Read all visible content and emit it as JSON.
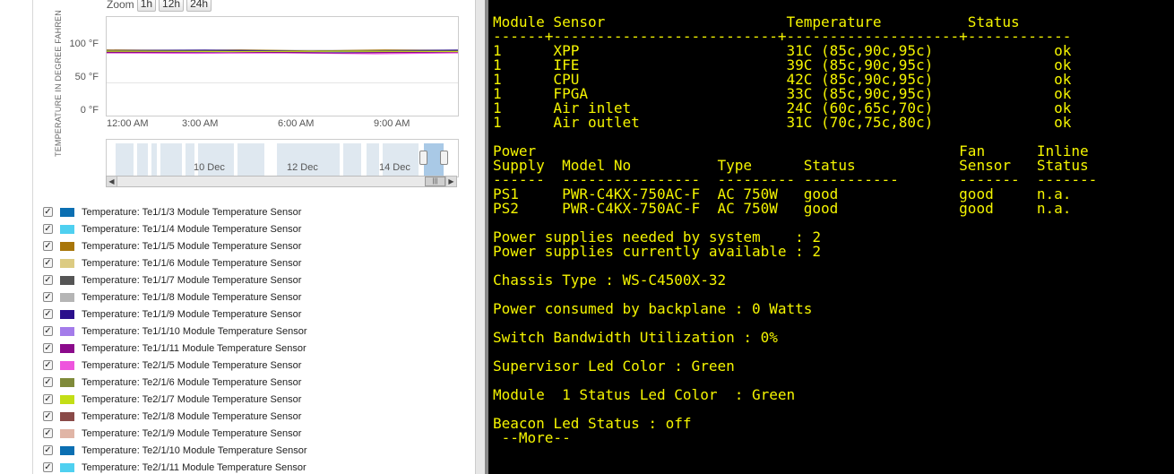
{
  "left_panel": {
    "zoom_label": "Zoom",
    "zoom_buttons": [
      "1h",
      "12h",
      "24h"
    ],
    "y_axis_label": "TEMPERATURE IN DEGREE FAHREN",
    "y_ticks": [
      "100 °F",
      "50 °F",
      "0 °F"
    ],
    "x_ticks": [
      "12:00 AM",
      "3:00 AM",
      "6:00 AM",
      "9:00 AM"
    ],
    "navigator_ticks": [
      "10 Dec",
      "12 Dec",
      "14 Dec"
    ],
    "legend": [
      {
        "label": "Temperature: Te1/1/3 Module Temperature Sensor",
        "color": "#0b6fb2"
      },
      {
        "label": "Temperature: Te1/1/4 Module Temperature Sensor",
        "color": "#4fd0f0"
      },
      {
        "label": "Temperature: Te1/1/5 Module Temperature Sensor",
        "color": "#a8760a"
      },
      {
        "label": "Temperature: Te1/1/6 Module Temperature Sensor",
        "color": "#dccb82"
      },
      {
        "label": "Temperature: Te1/1/7 Module Temperature Sensor",
        "color": "#555555"
      },
      {
        "label": "Temperature: Te1/1/8 Module Temperature Sensor",
        "color": "#b5b5b5"
      },
      {
        "label": "Temperature: Te1/1/9 Module Temperature Sensor",
        "color": "#2b0f8c"
      },
      {
        "label": "Temperature: Te1/1/10 Module Temperature Sensor",
        "color": "#a47cea"
      },
      {
        "label": "Temperature: Te1/1/11 Module Temperature Sensor",
        "color": "#8b0a8b"
      },
      {
        "label": "Temperature: Te2/1/5 Module Temperature Sensor",
        "color": "#ee55dd"
      },
      {
        "label": "Temperature: Te2/1/6 Module Temperature Sensor",
        "color": "#7f8a3a"
      },
      {
        "label": "Temperature: Te2/1/7 Module Temperature Sensor",
        "color": "#c3de16"
      },
      {
        "label": "Temperature: Te2/1/8 Module Temperature Sensor",
        "color": "#8a4a48"
      },
      {
        "label": "Temperature: Te2/1/9 Module Temperature Sensor",
        "color": "#e0b5a6"
      },
      {
        "label": "Temperature: Te2/1/10 Module Temperature Sensor",
        "color": "#0b6fb2"
      },
      {
        "label": "Temperature: Te2/1/11 Module Temperature Sensor",
        "color": "#4fd0f0"
      }
    ]
  },
  "terminal": {
    "text_color": "#f5f500",
    "background": "#000000",
    "lines": [
      "  ...",
      "",
      "Module Sensor                     Temperature          Status",
      "------+--------------------------+--------------------+------------",
      "1      XPP                        31C (85c,90c,95c)              ok",
      "1      IFE                        39C (85c,90c,95c)              ok",
      "1      CPU                        42C (85c,90c,95c)              ok",
      "1      FPGA                       33C (85c,90c,95c)              ok",
      "1      Air inlet                  24C (60c,65c,70c)              ok",
      "1      Air outlet                 31C (70c,75c,80c)              ok",
      "",
      "Power                                                 Fan      Inline",
      "Supply  Model No          Type      Status            Sensor   Status",
      "------  ----------------  --------- -----------       -------  -------",
      "PS1     PWR-C4KX-750AC-F  AC 750W   good              good     n.a.",
      "PS2     PWR-C4KX-750AC-F  AC 750W   good              good     n.a.",
      "",
      "Power supplies needed by system    : 2",
      "Power supplies currently available : 2",
      "",
      "Chassis Type : WS-C4500X-32",
      "",
      "Power consumed by backplane : 0 Watts",
      "",
      "Switch Bandwidth Utilization : 0%",
      "",
      "Supervisor Led Color : Green",
      "",
      "Module  1 Status Led Color  : Green",
      "",
      "Beacon Led Status : off",
      " --More--"
    ]
  }
}
